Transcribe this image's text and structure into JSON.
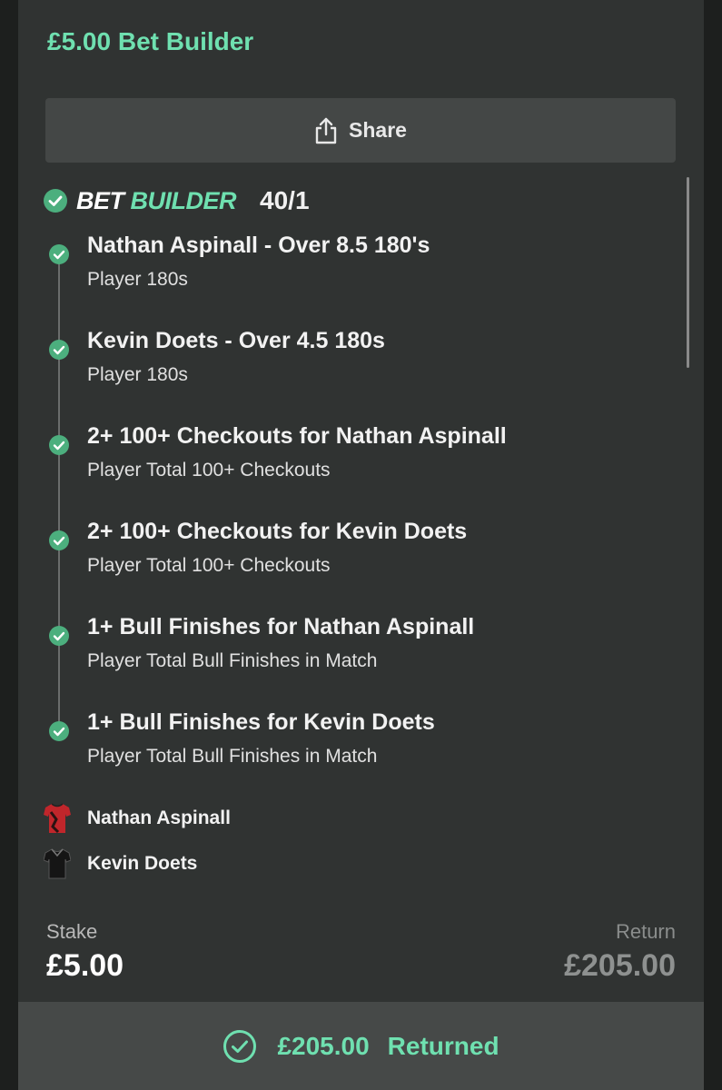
{
  "header": {
    "title": "£5.00 Bet Builder"
  },
  "share": {
    "label": "Share"
  },
  "bet_builder": {
    "logo_part1": "BET",
    "logo_part2": "BUILDER",
    "odds": "40/1"
  },
  "legs": [
    {
      "selection": "Nathan Aspinall - Over 8.5 180's",
      "market": "Player 180s"
    },
    {
      "selection": "Kevin Doets - Over 4.5 180s",
      "market": "Player 180s"
    },
    {
      "selection": "2+ 100+ Checkouts for Nathan Aspinall",
      "market": "Player Total 100+ Checkouts"
    },
    {
      "selection": "2+ 100+ Checkouts for Kevin Doets",
      "market": "Player Total 100+ Checkouts"
    },
    {
      "selection": "1+ Bull Finishes for Nathan Aspinall",
      "market": "Player Total Bull Finishes in Match"
    },
    {
      "selection": "1+ Bull Finishes for Kevin Doets",
      "market": "Player Total Bull Finishes in Match"
    }
  ],
  "players": [
    {
      "name": "Nathan Aspinall",
      "shirt_color": "#c0262b"
    },
    {
      "name": "Kevin Doets",
      "shirt_color": "#151515"
    }
  ],
  "stake": {
    "label": "Stake",
    "value": "£5.00"
  },
  "return": {
    "label": "Return",
    "value": "£205.00"
  },
  "result": {
    "amount": "£205.00",
    "status": "Returned"
  },
  "colors": {
    "accent": "#6fe0b0",
    "check_green": "#4caf7e",
    "background": "#303332"
  }
}
